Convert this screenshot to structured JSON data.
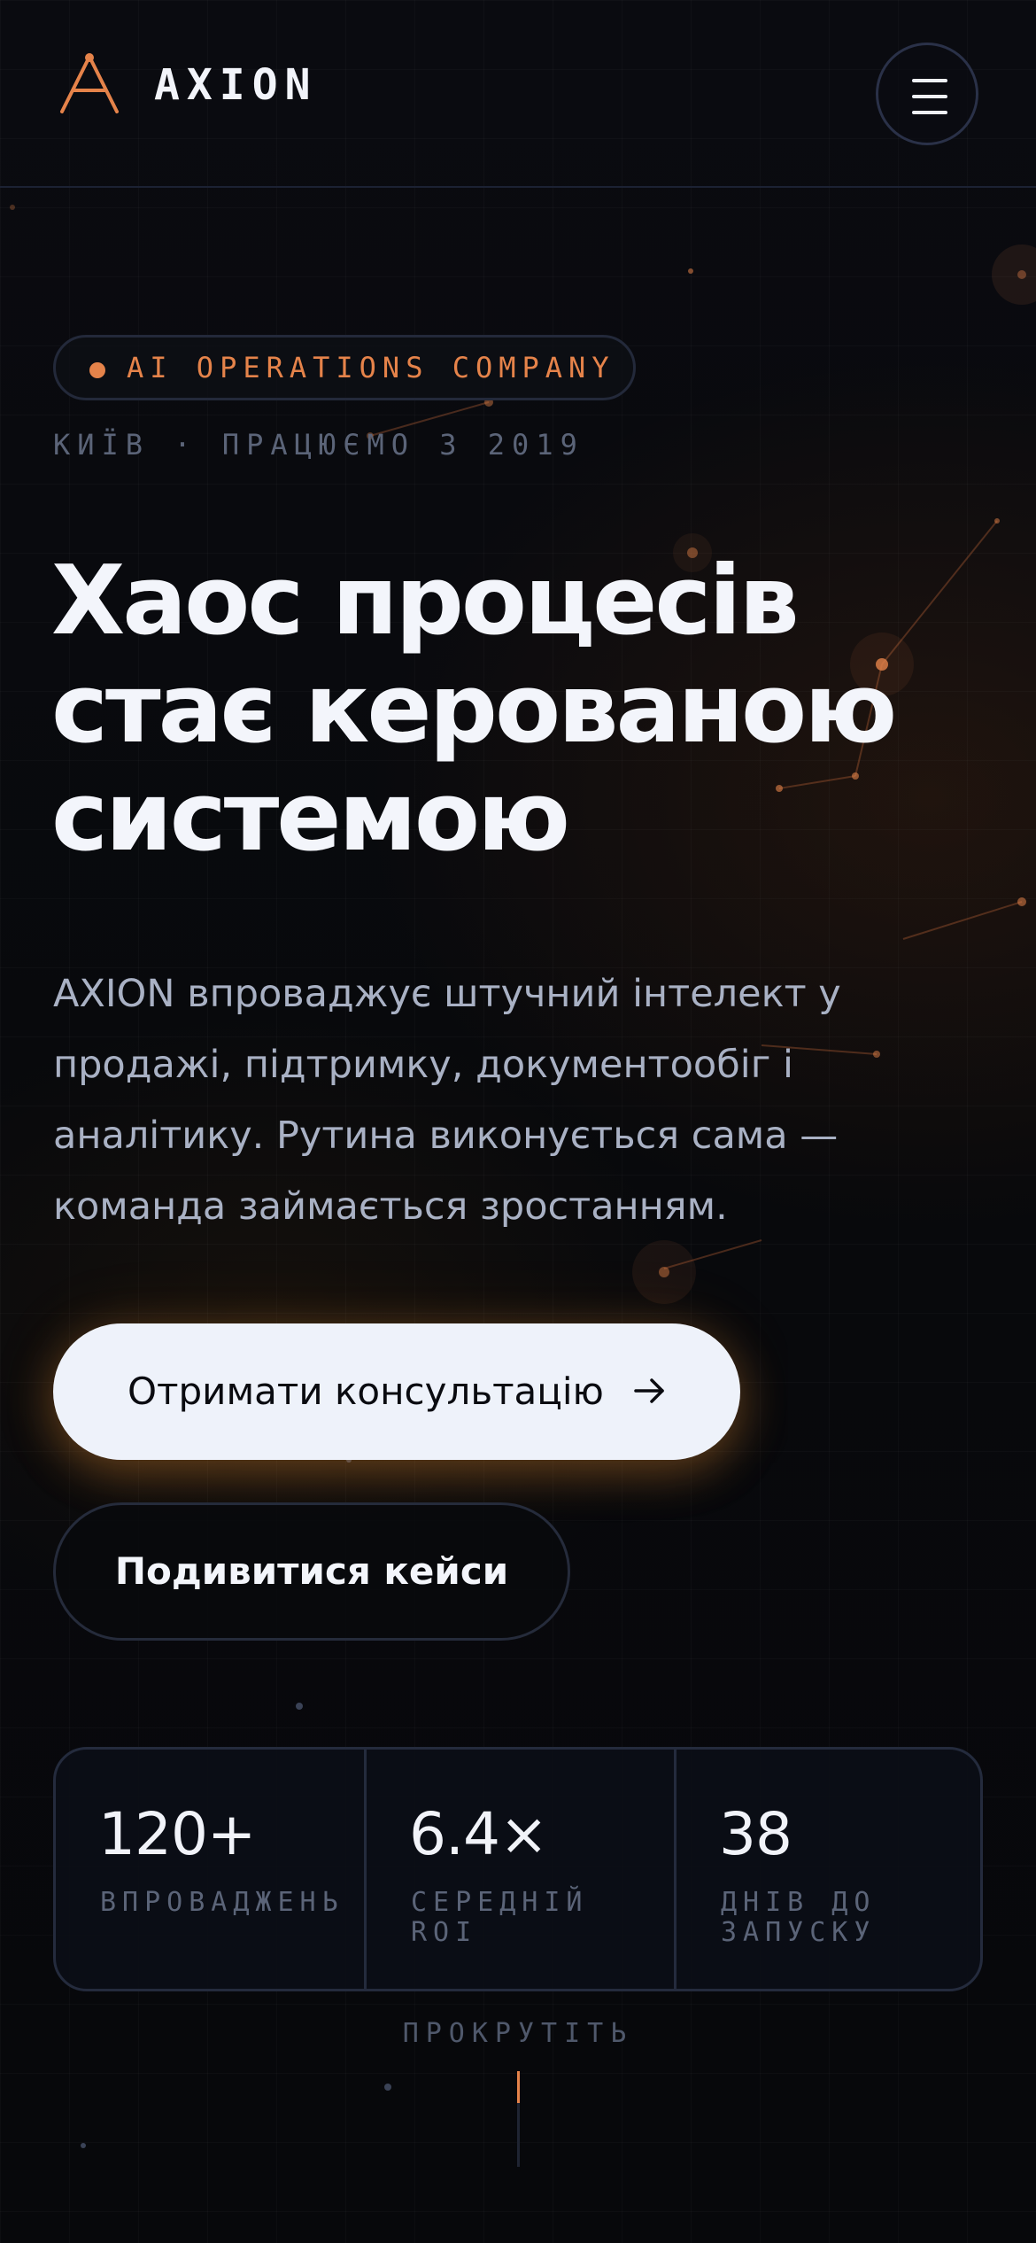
{
  "header": {
    "brand": "AXION",
    "logo_icon": "axion-a-logo-icon",
    "menu_icon": "hamburger-menu-icon"
  },
  "hero": {
    "badge": "AI OPERATIONS COMPANY",
    "meta": "КИЇВ · ПРАЦЮЄМО З 2019",
    "headline": [
      "Хаос процесів",
      "стає керованою",
      "системою"
    ],
    "lead": [
      "AXION впроваджує штучний інтелект у",
      "продажі, підтримку, документообіг і",
      "аналітику. Рутина виконується сама —",
      "команда займається зростанням."
    ]
  },
  "actions": {
    "primary_label": "Отримати консультацію",
    "primary_icon": "arrow-right-icon",
    "secondary_label": "Подивитися кейси"
  },
  "stats": [
    {
      "value": "120+",
      "caption": "ВПРОВАДЖЕНЬ"
    },
    {
      "value": "6.4×",
      "caption": "СЕРЕДНІЙ ROI"
    },
    {
      "value": "38",
      "caption": "ДНІВ ДО ЗАПУСКУ"
    }
  ],
  "scroll": {
    "label": "ПРОКРУТІТЬ"
  },
  "colors": {
    "background": "#07080b",
    "accent": "#e5834a",
    "text": "#f3f5fb",
    "muted": "#5b6478",
    "button_light": "#eef2fa"
  }
}
